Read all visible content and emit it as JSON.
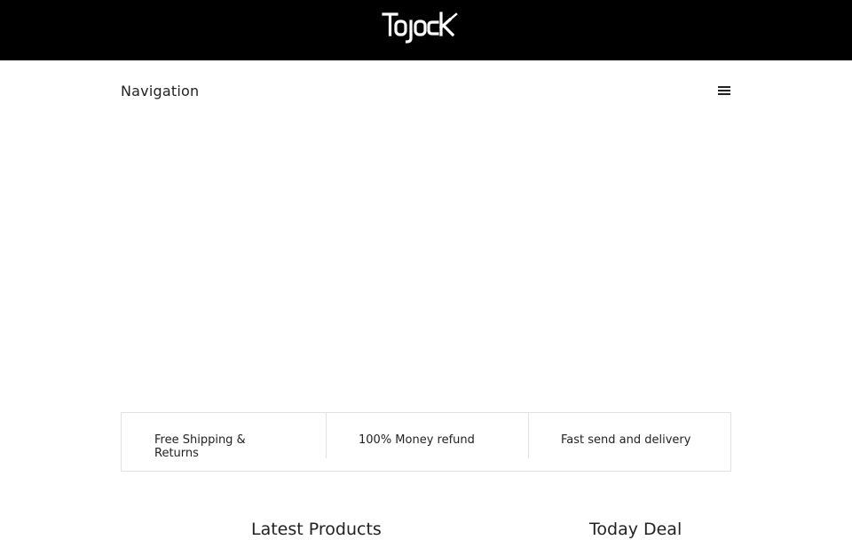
{
  "header": {
    "logo_text": "Tojock",
    "background_color": "#000000"
  },
  "nav": {
    "title": "Navigation",
    "menu_icon": "hamburger-icon"
  },
  "features": [
    {
      "label": "Free Shipping & Returns"
    },
    {
      "label": "100% Money refund"
    },
    {
      "label": "Fast send and delivery"
    }
  ],
  "sections": {
    "latest_products": "Latest Products",
    "today_deal": "Today Deal"
  }
}
